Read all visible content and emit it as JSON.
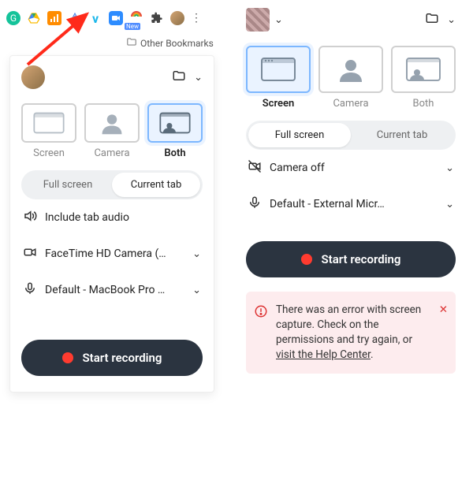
{
  "toolbar": {
    "new_badge": "New",
    "bookmarks_label": "Other Bookmarks"
  },
  "left": {
    "modes": {
      "screen": "Screen",
      "camera": "Camera",
      "both": "Both",
      "selected": "both"
    },
    "seg": {
      "full": "Full screen",
      "tab": "Current tab",
      "selected": "tab"
    },
    "audio_label": "Include tab audio",
    "camera_option": "FaceTime HD Camera (…",
    "mic_option": "Default - MacBook Pro …",
    "start": "Start recording"
  },
  "right": {
    "modes": {
      "screen": "Screen",
      "camera": "Camera",
      "both": "Both",
      "selected": "screen"
    },
    "seg": {
      "full": "Full screen",
      "tab": "Current tab",
      "selected": "full"
    },
    "camera_option": "Camera off",
    "mic_option": "Default - External Micr…",
    "start": "Start recording",
    "error_text": "There was an error with screen capture. Check on the permissions and try again, or ",
    "error_link": "visit the Help Center",
    "error_tail": "."
  }
}
